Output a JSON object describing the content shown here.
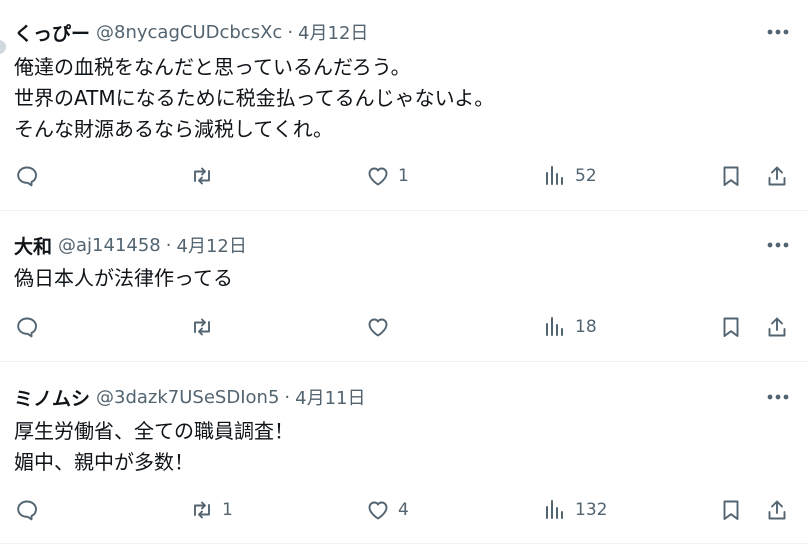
{
  "tweets": [
    {
      "name": "くっぴー",
      "handle": "@8nycagCUDcbcsXc",
      "separator": "·",
      "time": "4月12日",
      "lines": [
        "俺達の血税をなんだと思っているんだろう。",
        "世界のATMになるために税金払ってるんじゃないよ。",
        "そんな財源あるなら減税してくれ。"
      ],
      "replies": "",
      "retweets": "",
      "likes": "1",
      "views": "52"
    },
    {
      "name": "大和",
      "handle": "@aj141458",
      "separator": "·",
      "time": "4月12日",
      "lines": [
        "偽日本人が法律作ってる"
      ],
      "replies": "",
      "retweets": "",
      "likes": "",
      "views": "18"
    },
    {
      "name": "ミノムシ",
      "handle": "@3dazk7USeSDIon5",
      "separator": "·",
      "time": "4月11日",
      "lines": [
        "厚生労働省、全ての職員調査！",
        "媚中、親中が多数！"
      ],
      "replies": "",
      "retweets": "1",
      "likes": "4",
      "views": "132"
    }
  ],
  "icons": {
    "more": "more-horizontal-icon",
    "reply": "reply-icon",
    "retweet": "retweet-icon",
    "like": "heart-icon",
    "views": "analytics-icon",
    "bookmark": "bookmark-icon",
    "share": "share-icon"
  },
  "colors": {
    "text": "#0f1419",
    "secondary": "#536471",
    "divider": "#eff3f4"
  }
}
